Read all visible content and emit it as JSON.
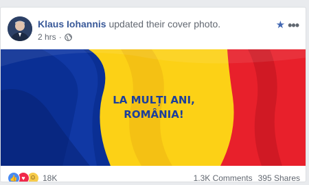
{
  "post": {
    "author": "Klaus Iohannis",
    "action": "updated their cover photo.",
    "time": "2 hrs",
    "privacy_icon": "globe-icon"
  },
  "header_icons": [
    "star-icon",
    "more-options-icon"
  ],
  "cover": {
    "line1": "LA MULȚI ANI,",
    "line2": "ROMÂNIA!",
    "colors": {
      "blue": "#0a2f94",
      "yellow": "#fcd116",
      "red": "#e8202b",
      "text": "#1b3f9c"
    }
  },
  "footer": {
    "reactions": [
      "like-icon",
      "love-icon",
      "haha-icon"
    ],
    "reaction_count": "18K",
    "comments": "1.3K Comments",
    "shares": "395 Shares"
  }
}
